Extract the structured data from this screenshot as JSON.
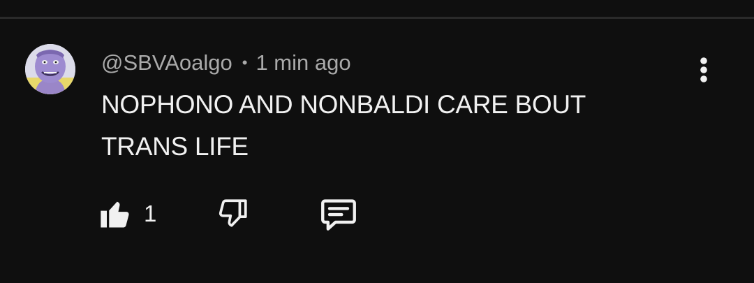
{
  "comment": {
    "author": "@SBVAoalgo",
    "separator": "•",
    "time": "1 min ago",
    "text": "NOPHONO AND NONBALDI CARE BOUT TRANS LIFE",
    "like_count": "1"
  },
  "icons": {
    "like": "thumbs-up-icon",
    "dislike": "thumbs-down-icon",
    "reply": "reply-comment-icon",
    "more": "more-vertical-icon"
  },
  "colors": {
    "background": "#0f0f0f",
    "text_primary": "#f1f1f1",
    "text_secondary": "#aaaaaa",
    "divider": "#2a2a2a"
  }
}
